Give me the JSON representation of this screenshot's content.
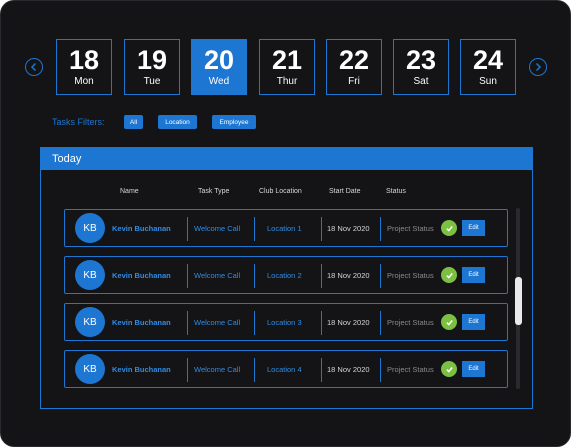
{
  "days": [
    {
      "num": "18",
      "dow": "Mon"
    },
    {
      "num": "19",
      "dow": "Tue"
    },
    {
      "num": "20",
      "dow": "Wed"
    },
    {
      "num": "21",
      "dow": "Thur"
    },
    {
      "num": "22",
      "dow": "Fri"
    },
    {
      "num": "23",
      "dow": "Sat"
    },
    {
      "num": "24",
      "dow": "Sun"
    }
  ],
  "active_day": "20",
  "filters": {
    "label": "Tasks Filters:",
    "options": [
      "All",
      "Location",
      "Employee"
    ]
  },
  "panel": {
    "title": "Today",
    "columns": [
      "Name",
      "Task Type",
      "Club Location",
      "Start Date",
      "Status"
    ]
  },
  "rows": [
    {
      "initials": "KB",
      "name": "Kevin Buchanan",
      "task_type": "Welcome Call",
      "location": "Location 1",
      "start_date": "18 Nov 2020",
      "status": "Project Status",
      "edit": "Edit"
    },
    {
      "initials": "KB",
      "name": "Kevin Buchanan",
      "task_type": "Welcome Call",
      "location": "Location 2",
      "start_date": "18 Nov 2020",
      "status": "Project Status",
      "edit": "Edit"
    },
    {
      "initials": "KB",
      "name": "Kevin Buchanan",
      "task_type": "Welcome Call",
      "location": "Location 3",
      "start_date": "18 Nov 2020",
      "status": "Project Status",
      "edit": "Edit"
    },
    {
      "initials": "KB",
      "name": "Kevin Buchanan",
      "task_type": "Welcome Call",
      "location": "Location 4",
      "start_date": "18 Nov 2020",
      "status": "Project Status",
      "edit": "Edit"
    }
  ],
  "colors": {
    "accent": "#1d76d2",
    "background": "#141416",
    "success": "#7bc043"
  },
  "icons": {
    "prev": "chevron-left-icon",
    "next": "chevron-right-icon",
    "status": "check-circle-icon"
  }
}
